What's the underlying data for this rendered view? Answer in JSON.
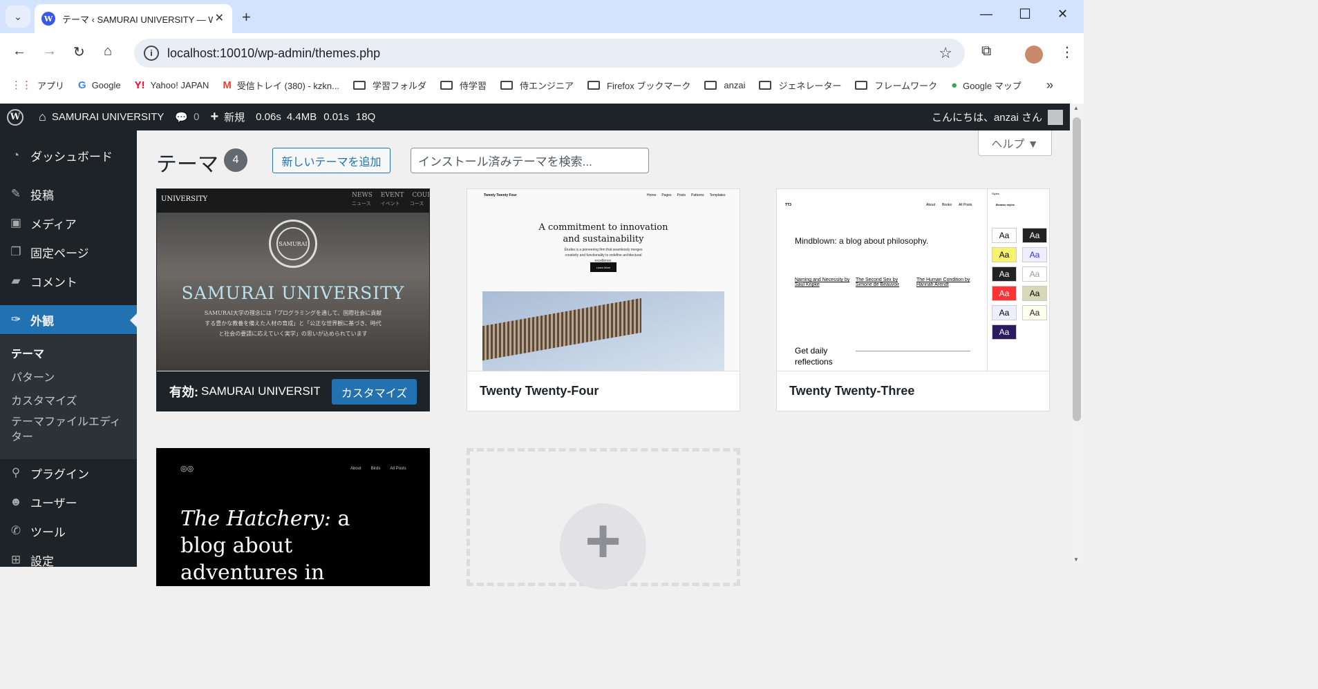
{
  "browser": {
    "tab_title": "テーマ ‹ SAMURAI UNIVERSITY — W",
    "url": "localhost:10010/wp-admin/themes.php",
    "bookmarks": [
      "アプリ",
      "Google",
      "Yahoo! JAPAN",
      "受信トレイ (380) - kzkn...",
      "学習フォルダ",
      "侍学習",
      "侍エンジニア",
      "Firefox ブックマーク",
      "anzai",
      "ジェネレーター",
      "フレームワーク",
      "Google マップ"
    ]
  },
  "adminbar": {
    "site_name": "SAMURAI UNIVERSITY",
    "comments": "0",
    "new": "新規",
    "perf": [
      "0.06s",
      "4.4MB",
      "0.01s",
      "18Q"
    ],
    "greeting": "こんにちは、anzai さん"
  },
  "sidebar": {
    "dashboard": "ダッシュボード",
    "posts": "投稿",
    "media": "メディア",
    "pages": "固定ページ",
    "comments": "コメント",
    "appearance": "外観",
    "sub": [
      "テーマ",
      "パターン",
      "カスタマイズ",
      "テーマファイルエディター"
    ],
    "plugins": "プラグイン",
    "users": "ユーザー",
    "tools": "ツール",
    "settings": "設定"
  },
  "main": {
    "title": "テーマ",
    "count": "4",
    "add_new": "新しいテーマを追加",
    "search_placeholder": "インストール済みテーマを検索...",
    "help": "ヘルプ ▼",
    "active_label": "有効:",
    "active_name": "SAMURAI UNIVERSITY",
    "customize": "カスタマイズ",
    "themes": [
      "Twenty Twenty-Four",
      "Twenty Twenty-Three"
    ]
  },
  "shots": {
    "samurai": {
      "nav_left": "UNIVERSITY",
      "nav": [
        "NEWS",
        "EVENT",
        "COURSE"
      ],
      "nav_sub": [
        "ニュース",
        "イベント",
        "コース"
      ],
      "emblem": "SAMURAI",
      "heading": "SAMURAI UNIVERSITY",
      "body": "SAMURAI大学の理念には「プログラミングを通して、国際社会に貢献する豊かな教養を備えた人材の育成」と「公正な世界観に基づき、時代と社会の要請に応えていく実学」の思いが込められています"
    },
    "t24": {
      "brand": "Twenty Twenty Four",
      "nav": [
        "Home",
        "Pages",
        "Posts",
        "Patterns",
        "Templates"
      ],
      "heading": "A commitment to innovation and sustainability",
      "body": "Études is a pioneering firm that seamlessly merges creativity and functionality to redefine architectural excellence.",
      "btn": "Learn More"
    },
    "t23": {
      "brand": "TT3",
      "nav": [
        "About",
        "Books",
        "All Posts"
      ],
      "heading": "Mindblown: a blog about philosophy.",
      "posts": [
        "Naming and Necessity by Saul Kripke",
        "The Second Sex by Simone de Beauvoir",
        "The Human Condition by Hannah Arendt"
      ],
      "footer": "Get daily reflections",
      "styles": "Styles",
      "browse": "Browse styles"
    },
    "hatchery": {
      "nav": [
        "About",
        "Birds",
        "All Posts"
      ],
      "heading_em": "The Hatchery:",
      "heading": " a blog about adventures in"
    }
  }
}
